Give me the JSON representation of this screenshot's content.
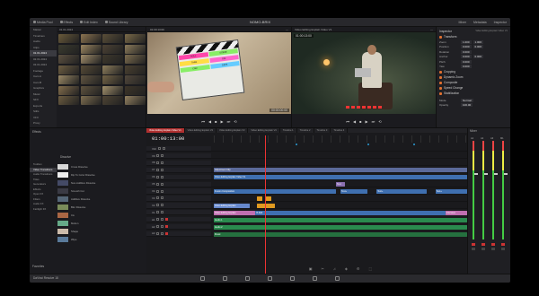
{
  "topbar": {
    "project_title": "NOMO-BRIX",
    "left_tabs": [
      "Media Pool",
      "Effects",
      "Edit Index",
      "Sound Library"
    ],
    "right_tabs": [
      "Mixer",
      "Metadata",
      "Inspector"
    ]
  },
  "media": {
    "bins": [
      "Master",
      "Timelines",
      "Audio",
      "Clips",
      "01.01.2024",
      "02.01.2024",
      "03.01.2024",
      "Footage",
      "Cam A",
      "Cam B",
      "Graphics",
      "Music",
      "SFX",
      "Exports",
      "Stills",
      "VFX",
      "Proxy",
      "Titles",
      "Archive"
    ],
    "selected_bin": 4,
    "grid_header": "01.01.2024",
    "thumb_colors": [
      "#6a5a3a",
      "#8c7450",
      "#5a4e38",
      "#7a6a48",
      "#3a3a2e",
      "#9a8560",
      "#4c4234",
      "#8a7a5a",
      "#5c5040",
      "#a08c6a",
      "#3e382c",
      "#7c6c4e",
      "#6e5e42",
      "#564a36",
      "#8e7e5c",
      "#4a4030",
      "#9c8a66",
      "#605440",
      "#746446",
      "#50463a",
      "#846e4c",
      "#5e523e",
      "#a2906c",
      "#3c3428",
      "#6c5c40",
      "#7e6e50",
      "#4e4434",
      "#928060"
    ]
  },
  "viewer_left": {
    "header": "01:00:13:00",
    "timecode": "00:00:00:00",
    "slate_cells": [
      "ROLL",
      "SCENE",
      "TAKE",
      "DIR",
      "CAM",
      "DATE"
    ]
  },
  "viewer_right": {
    "header": "Video Editing Explain Video V1",
    "timecode": "01:00:13:00"
  },
  "controls": [
    "⏮",
    "◀",
    "■",
    "▶",
    "⏭",
    "⟲"
  ],
  "inspector": {
    "title": "Inspector",
    "subtitle": "Video Editing Explain Video V1",
    "section_transform": "Transform",
    "rows": [
      {
        "label": "Zoom",
        "x": "1.000",
        "y": "1.000"
      },
      {
        "label": "Position",
        "x": "0.000",
        "y": "0.000"
      },
      {
        "label": "Rotation",
        "x": "0.000",
        "y": ""
      },
      {
        "label": "Anchor",
        "x": "0.000",
        "y": "0.000"
      },
      {
        "label": "Pitch",
        "x": "0.000",
        "y": ""
      },
      {
        "label": "Yaw",
        "x": "0.000",
        "y": ""
      }
    ],
    "sections": [
      "Cropping",
      "Dynamic Zoom",
      "Composite",
      "Speed Change",
      "Stabilization"
    ],
    "composite_mode": "Normal",
    "opacity": "100.00"
  },
  "effects": {
    "header": "Effects",
    "toolbox": [
      "Toolbox",
      "Video Transitions",
      "Audio Transitions",
      "Titles",
      "Generators",
      "Effects",
      "Open FX",
      "Filters",
      "Audio FX",
      "Fairlight FX"
    ],
    "selected_toolbox": 1,
    "transitions_header": "Dissolve",
    "transitions": [
      {
        "name": "Cross Dissolve",
        "color": "#d8d8d8"
      },
      {
        "name": "Dip To Color Dissolve",
        "color": "#eeeeee"
      },
      {
        "name": "Non-Additive Dissolve",
        "color": "#444a66"
      },
      {
        "name": "Smooth Cut",
        "color": "#3a3a44"
      },
      {
        "name": "Additive Dissolve",
        "color": "#556677"
      },
      {
        "name": "Blur Dissolve",
        "color": "#7a8c5a"
      },
      {
        "name": "Iris",
        "color": "#aa6644"
      },
      {
        "name": "Motion",
        "color": "#66aa88"
      },
      {
        "name": "Shape",
        "color": "#ccbbaa"
      },
      {
        "name": "Wipe",
        "color": "#5a7a9a"
      }
    ],
    "favorites": "Favorites"
  },
  "timeline": {
    "tabs": [
      "Video Editing Explain Video V1",
      "Video Editing Explain V2",
      "Video Editing Explain V3",
      "Video Editing Explain V4",
      "Timeline 1",
      "Timeline 2",
      "Timeline 3",
      "Timeline 4"
    ],
    "active_tab": 0,
    "timecode": "01:00:13:00",
    "tracks": [
      {
        "name": "V10",
        "type": "v"
      },
      {
        "name": "V9",
        "type": "v"
      },
      {
        "name": "V8",
        "type": "v"
      },
      {
        "name": "V7",
        "type": "v"
      },
      {
        "name": "V6",
        "type": "v"
      },
      {
        "name": "V5",
        "type": "v"
      },
      {
        "name": "V4",
        "type": "v"
      },
      {
        "name": "V3",
        "type": "v"
      },
      {
        "name": "V2",
        "type": "v"
      },
      {
        "name": "V1",
        "type": "v"
      },
      {
        "name": "A1",
        "type": "a"
      },
      {
        "name": "A2",
        "type": "a"
      },
      {
        "name": "A3",
        "type": "a"
      }
    ],
    "clips": [
      {
        "track": 4,
        "start": 0,
        "len": 280,
        "color": "#5b6a9a",
        "label": "Adjustment Clip"
      },
      {
        "track": 5,
        "start": 0,
        "len": 280,
        "color": "#3f6fb0",
        "label": "Video Editing Explain Video V1"
      },
      {
        "track": 6,
        "start": 135,
        "len": 10,
        "color": "#8a6fb0",
        "label": "Text"
      },
      {
        "track": 7,
        "start": 0,
        "len": 135,
        "color": "#3f6fb0",
        "label": "Fusion Composition"
      },
      {
        "track": 7,
        "start": 140,
        "len": 30,
        "color": "#3f6fb0",
        "label": "Text+"
      },
      {
        "track": 7,
        "start": 180,
        "len": 55,
        "color": "#3f6fb0",
        "label": "Text+"
      },
      {
        "track": 7,
        "start": 245,
        "len": 35,
        "color": "#3f6fb0",
        "label": "Text+"
      },
      {
        "track": 8,
        "start": 48,
        "len": 6,
        "color": "#e09a20",
        "label": ""
      },
      {
        "track": 8,
        "start": 58,
        "len": 6,
        "color": "#e09a20",
        "label": ""
      },
      {
        "track": 9,
        "start": 0,
        "len": 40,
        "color": "#6688cc",
        "label": "Video Editing Explain"
      },
      {
        "track": 9,
        "start": 48,
        "len": 20,
        "color": "#e09a20",
        "label": ""
      },
      {
        "track": 10,
        "start": 0,
        "len": 46,
        "color": "#c06fb0",
        "label": "Video Editing Explain"
      },
      {
        "track": 10,
        "start": 46,
        "len": 210,
        "color": "#3f6fb0",
        "label": "B-Roll"
      },
      {
        "track": 10,
        "start": 256,
        "len": 24,
        "color": "#c06fb0",
        "label": "Interview"
      },
      {
        "track": 11,
        "start": 0,
        "len": 280,
        "color": "#2a8a4e",
        "label": "Audio 1"
      },
      {
        "track": 12,
        "start": 0,
        "len": 280,
        "color": "#2a8a4e",
        "label": "Audio 2"
      },
      {
        "track": 13,
        "start": 0,
        "len": 280,
        "color": "#25703f",
        "label": "Music"
      }
    ],
    "markers": [
      {
        "pos": 170,
        "color": "#2a9bd6"
      },
      {
        "pos": 220,
        "color": "#2a9bd6"
      },
      {
        "pos": 90,
        "color": "#2a9bd6"
      }
    ],
    "bottom_icons": [
      "▣",
      "✂",
      "♫",
      "◈",
      "⚙",
      "⬚"
    ]
  },
  "mixer": {
    "header": "Mixer",
    "channels": [
      "A1",
      "A2",
      "A3",
      "M1"
    ]
  },
  "brand": "DaVinci Resolve 18",
  "dock_pages": [
    "Media",
    "Cut",
    "Edit",
    "Fusion",
    "Color",
    "Fairlight",
    "Deliver"
  ]
}
